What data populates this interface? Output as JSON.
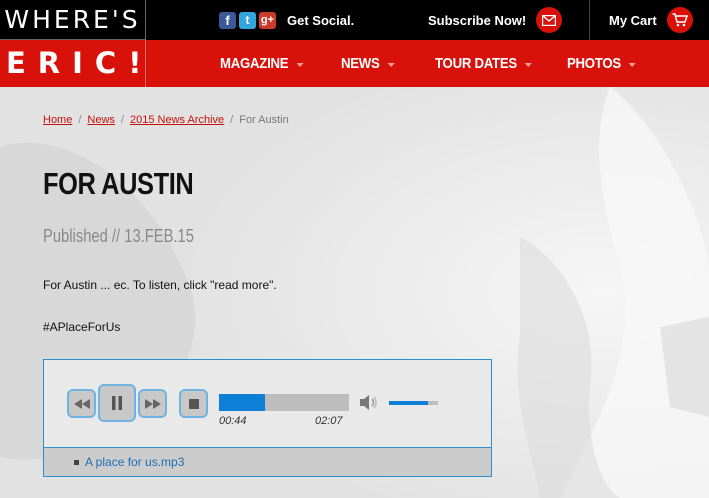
{
  "logo": {
    "top": "WHERE'S",
    "bottom": "ERIC!"
  },
  "header": {
    "social": {
      "facebook_glyph": "f",
      "twitter_glyph": "t",
      "gplus_glyph": "g+",
      "label": "Get Social."
    },
    "subscribe_label": "Subscribe Now!",
    "cart_label": "My Cart"
  },
  "nav": {
    "items": [
      "MAGAZINE",
      "NEWS",
      "TOUR DATES",
      "PHOTOS"
    ]
  },
  "breadcrumb": {
    "items": [
      "Home",
      "News",
      "2015 News Archive"
    ],
    "current": "For Austin",
    "separator": "/"
  },
  "article": {
    "title": "FOR AUSTIN",
    "published": "Published // 13.FEB.15",
    "body": "For Austin ... ec.  To listen, click \"read more\".",
    "hashtag": "#APlaceForUs"
  },
  "player": {
    "current_time": "00:44",
    "duration": "02:07",
    "progress": 0.35,
    "volume": 0.8,
    "playlist": [
      "A place for us.mp3"
    ]
  },
  "colors": {
    "brand_red": "#d8120b",
    "player_blue": "#0e7fd6",
    "link_red": "#c4120c"
  }
}
